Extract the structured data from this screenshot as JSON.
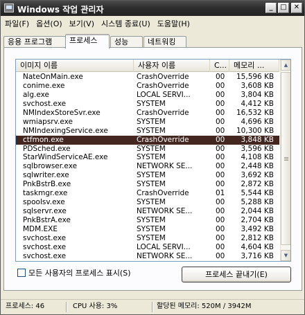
{
  "window": {
    "title": "Windows 작업 관리자"
  },
  "menu": [
    "파일(F)",
    "옵션(O)",
    "보기(V)",
    "시스템 종료(U)",
    "도움말(H)"
  ],
  "tabs": [
    "응용 프로그램",
    "프로세스",
    "성능",
    "네트워킹"
  ],
  "active_tab": "프로세스",
  "columns": [
    "이미지 이름",
    "사용자 이름",
    "C...",
    "메모리 ..."
  ],
  "processes": [
    {
      "name": "NateOnMain.exe",
      "user": "CrashOverride",
      "cpu": "00",
      "mem": "15,596 KB"
    },
    {
      "name": "conime.exe",
      "user": "CrashOverride",
      "cpu": "00",
      "mem": "3,608 KB"
    },
    {
      "name": "alg.exe",
      "user": "LOCAL SERVI...",
      "cpu": "00",
      "mem": "3,804 KB"
    },
    {
      "name": "svchost.exe",
      "user": "SYSTEM",
      "cpu": "00",
      "mem": "4,412 KB"
    },
    {
      "name": "NMIndexStoreSvr.exe",
      "user": "CrashOverride",
      "cpu": "00",
      "mem": "16,532 KB"
    },
    {
      "name": "wmiapsrv.exe",
      "user": "SYSTEM",
      "cpu": "00",
      "mem": "4,696 KB"
    },
    {
      "name": "NMIndexingService.exe",
      "user": "SYSTEM",
      "cpu": "00",
      "mem": "10,300 KB"
    },
    {
      "name": "ctfmon.exe",
      "user": "CrashOverride",
      "cpu": "00",
      "mem": "3,848 KB"
    },
    {
      "name": "PDSched.exe",
      "user": "SYSTEM",
      "cpu": "00",
      "mem": "3,596 KB"
    },
    {
      "name": "StarWindServiceAE.exe",
      "user": "SYSTEM",
      "cpu": "00",
      "mem": "4,108 KB"
    },
    {
      "name": "sqlbrowser.exe",
      "user": "NETWORK SE...",
      "cpu": "00",
      "mem": "2,448 KB"
    },
    {
      "name": "sqlwriter.exe",
      "user": "SYSTEM",
      "cpu": "00",
      "mem": "3,692 KB"
    },
    {
      "name": "PnkBstrB.exe",
      "user": "SYSTEM",
      "cpu": "00",
      "mem": "2,872 KB"
    },
    {
      "name": "taskmgr.exe",
      "user": "CrashOverride",
      "cpu": "01",
      "mem": "5,544 KB"
    },
    {
      "name": "spoolsv.exe",
      "user": "SYSTEM",
      "cpu": "00",
      "mem": "5,288 KB"
    },
    {
      "name": "sqlservr.exe",
      "user": "NETWORK SE...",
      "cpu": "00",
      "mem": "2,044 KB"
    },
    {
      "name": "PnkBstrA.exe",
      "user": "SYSTEM",
      "cpu": "00",
      "mem": "2,704 KB"
    },
    {
      "name": "MDM.EXE",
      "user": "SYSTEM",
      "cpu": "00",
      "mem": "3,492 KB"
    },
    {
      "name": "svchost.exe",
      "user": "SYSTEM",
      "cpu": "00",
      "mem": "2,812 KB"
    },
    {
      "name": "svchost.exe",
      "user": "LOCAL SERVI...",
      "cpu": "00",
      "mem": "4,604 KB"
    },
    {
      "name": "svchost.exe",
      "user": "NETWORK SE...",
      "cpu": "00",
      "mem": "3,716 KB"
    }
  ],
  "selected_process": "ctfmon.exe",
  "show_all_users_label": "모든 사용자의 프로세스 표시(S)",
  "end_process_label": "프로세스 끝내기(E)",
  "status": {
    "processes": "프로세스: 46",
    "cpu": "CPU 사용: 3%",
    "memory": "할당된 메모리: 520M / 3942M"
  },
  "colors": {
    "titlebar": "#2f2f2f",
    "selection": "#42261f",
    "face": "#ece9d8"
  }
}
